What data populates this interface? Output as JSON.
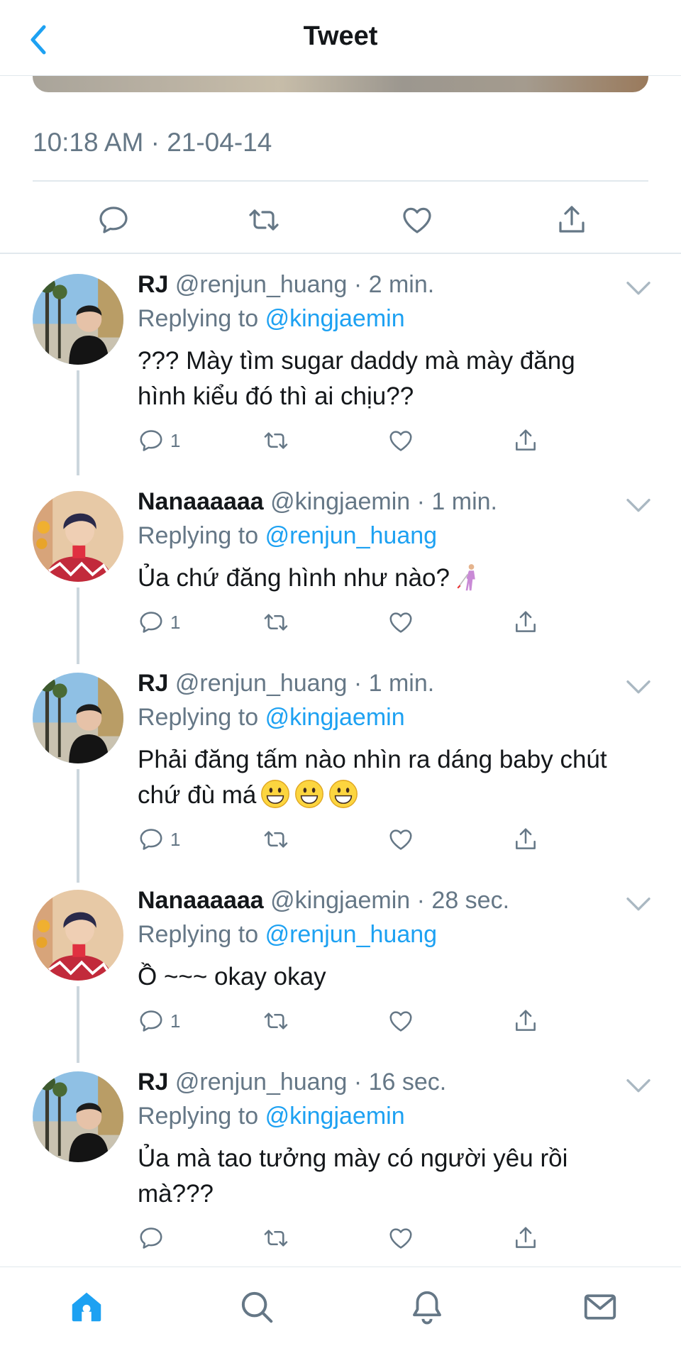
{
  "header": {
    "title": "Tweet"
  },
  "tweet": {
    "timestamp": "10:18 AM · 21-04-14"
  },
  "colors": {
    "accent": "#1da1f2",
    "muted": "#657786",
    "border": "#e1e8ed",
    "thread": "#ccd6dd"
  },
  "replies": [
    {
      "name": "RJ",
      "handle": "@renjun_huang",
      "time": "· 2 min.",
      "replying_label": "Replying to",
      "mention": "@kingjaemin",
      "text_lines": [
        "??? Mày tìm sugar daddy mà mày đăng",
        "hình kiểu đó thì ai chịu??"
      ],
      "reply_count": "1"
    },
    {
      "name": "Nanaaaaaa",
      "handle": "@kingjaemin",
      "time": "· 1 min.",
      "replying_label": "Replying to",
      "mention": "@renjun_huang",
      "text_lines": [
        "Ủa chứ đăng hình như nào?"
      ],
      "emoji": "person-with-white-cane",
      "reply_count": "1"
    },
    {
      "name": "RJ",
      "handle": "@renjun_huang",
      "time": "· 1 min.",
      "replying_label": "Replying to",
      "mention": "@kingjaemin",
      "text_lines": [
        "Phải đăng tấm nào nhìn ra dáng baby chút",
        "chứ đù má"
      ],
      "emoji": "grinning-face x3",
      "reply_count": "1"
    },
    {
      "name": "Nanaaaaaa",
      "handle": "@kingjaemin",
      "time": "· 28 sec.",
      "replying_label": "Replying to",
      "mention": "@renjun_huang",
      "text_lines": [
        "Ồ ~~~ okay okay"
      ],
      "reply_count": "1"
    },
    {
      "name": "RJ",
      "handle": "@renjun_huang",
      "time": "· 16 sec.",
      "replying_label": "Replying to",
      "mention": "@kingjaemin",
      "text_lines": [
        "Ủa mà tao tưởng mày có người yêu rồi",
        "mà???"
      ],
      "reply_count": ""
    }
  ],
  "tabbar": {
    "items": [
      "home-icon",
      "search-icon",
      "notifications-icon",
      "messages-icon"
    ],
    "active": "home-icon"
  }
}
